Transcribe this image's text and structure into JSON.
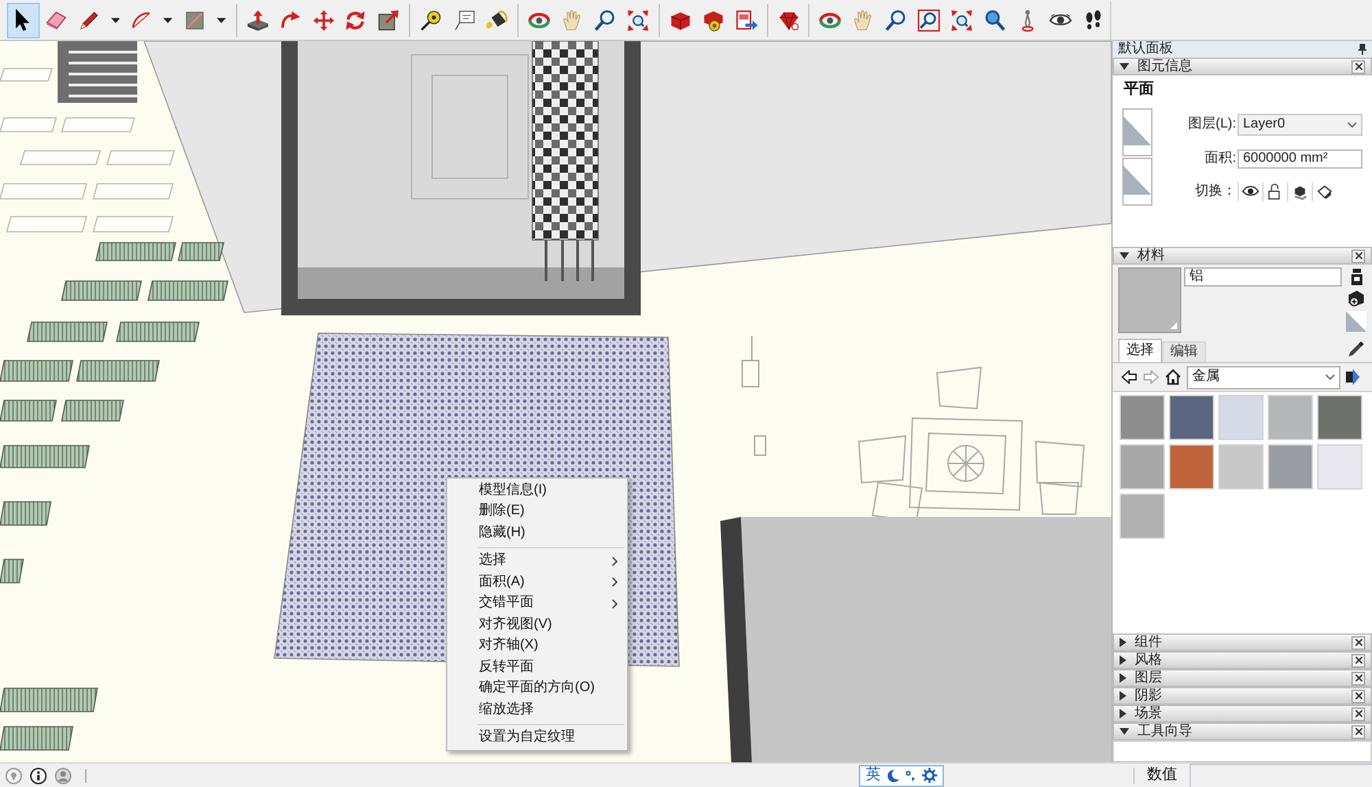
{
  "toolbar": {
    "groups": [
      [
        {
          "kind": "select",
          "selected": true,
          "dropdown": false
        },
        {
          "kind": "eraser",
          "selected": false,
          "dropdown": false
        },
        {
          "kind": "pencil",
          "selected": false,
          "dropdown": true
        },
        {
          "kind": "arc",
          "selected": false,
          "dropdown": true
        },
        {
          "kind": "rectangle",
          "selected": false,
          "dropdown": true
        }
      ],
      [
        {
          "kind": "pushpull",
          "selected": false,
          "dropdown": false
        },
        {
          "kind": "followme",
          "selected": false,
          "dropdown": false
        },
        {
          "kind": "move",
          "selected": false,
          "dropdown": false
        },
        {
          "kind": "rotate",
          "selected": false,
          "dropdown": false
        },
        {
          "kind": "scale",
          "selected": false,
          "dropdown": false
        }
      ],
      [
        {
          "kind": "tape",
          "selected": false,
          "dropdown": false
        },
        {
          "kind": "text",
          "selected": false,
          "dropdown": false
        },
        {
          "kind": "paint",
          "selected": false,
          "dropdown": false
        }
      ],
      [
        {
          "kind": "orbit",
          "selected": false,
          "dropdown": false
        },
        {
          "kind": "pan",
          "selected": false,
          "dropdown": false
        },
        {
          "kind": "zoom",
          "selected": false,
          "dropdown": false
        },
        {
          "kind": "extents",
          "selected": false,
          "dropdown": false
        }
      ],
      [
        {
          "kind": "warehouse",
          "selected": false,
          "dropdown": false
        },
        {
          "kind": "extensions",
          "selected": false,
          "dropdown": false
        },
        {
          "kind": "layout",
          "selected": false,
          "dropdown": false
        }
      ],
      [
        {
          "kind": "ruby",
          "selected": false,
          "dropdown": false
        }
      ],
      [
        {
          "kind": "orbit",
          "selected": false,
          "dropdown": false
        },
        {
          "kind": "pan",
          "selected": false,
          "dropdown": false
        },
        {
          "kind": "zoom",
          "selected": false,
          "dropdown": false
        },
        {
          "kind": "zoomwindow",
          "selected": false,
          "dropdown": false
        },
        {
          "kind": "extents",
          "selected": false,
          "dropdown": false
        },
        {
          "kind": "previous",
          "selected": false,
          "dropdown": false
        },
        {
          "kind": "camera",
          "selected": false,
          "dropdown": false
        },
        {
          "kind": "lookaround",
          "selected": false,
          "dropdown": false
        },
        {
          "kind": "walk",
          "selected": false,
          "dropdown": false
        }
      ]
    ]
  },
  "viewport": {
    "context_menu": {
      "groups": [
        [
          {
            "label": "模型信息(I)",
            "submenu": false
          },
          {
            "label": "删除(E)",
            "submenu": false
          },
          {
            "label": "隐藏(H)",
            "submenu": false
          }
        ],
        [
          {
            "label": "选择",
            "submenu": true
          },
          {
            "label": "面积(A)",
            "submenu": true
          },
          {
            "label": "交错平面",
            "submenu": true
          },
          {
            "label": "对齐视图(V)",
            "submenu": false
          },
          {
            "label": "对齐轴(X)",
            "submenu": false
          },
          {
            "label": "反转平面",
            "submenu": false
          },
          {
            "label": "确定平面的方向(O)",
            "submenu": false
          },
          {
            "label": "缩放选择",
            "submenu": false
          }
        ],
        [
          {
            "label": "设置为自定纹理",
            "submenu": false
          }
        ]
      ]
    }
  },
  "tray": {
    "title": "默认面板",
    "entity_info": {
      "title": "图元信息",
      "expanded": true,
      "entity_type": "平面",
      "layer_label": "图层(L):",
      "layer": "Layer0",
      "area_label": "面积:",
      "area": "6000000 mm²",
      "toggle_label": "切换："
    },
    "materials": {
      "title": "材料",
      "expanded": true,
      "name": "铝",
      "tabs": [
        {
          "label": "选择",
          "selected": true
        },
        {
          "label": "编辑",
          "selected": false
        }
      ],
      "collection": "金属",
      "swatches": [
        {
          "color": "#8d8d8d",
          "selected": false
        },
        {
          "color": "#5c6680",
          "selected": false
        },
        {
          "color": "#d4dbe6",
          "selected": false
        },
        {
          "color": "#b4b6b8",
          "selected": false
        },
        {
          "color": "#6f716c",
          "selected": false
        },
        {
          "color": "#a8a8a8",
          "selected": false
        },
        {
          "color": "#c0643c",
          "selected": false
        },
        {
          "color": "#c8c8c8",
          "selected": false
        },
        {
          "color": "#9a9ea2",
          "selected": false
        },
        {
          "color": "#e8e8ee",
          "selected": false
        },
        {
          "color": "#b0b0b0",
          "selected": false
        }
      ]
    },
    "panels": [
      {
        "title": "组件",
        "expanded": false
      },
      {
        "title": "风格",
        "expanded": false
      },
      {
        "title": "图层",
        "expanded": false
      },
      {
        "title": "阴影",
        "expanded": false
      },
      {
        "title": "场景",
        "expanded": false
      },
      {
        "title": "工具向导",
        "expanded": true
      }
    ]
  },
  "status_bar": {
    "ime_mode": "英",
    "measurements_label": "数值"
  }
}
